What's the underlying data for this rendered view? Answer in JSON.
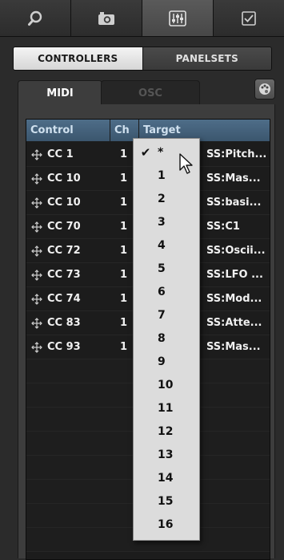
{
  "toolbar": {
    "tabs": [
      {
        "icon": "search-icon"
      },
      {
        "icon": "camera-icon"
      },
      {
        "icon": "mixer-sliders-icon"
      },
      {
        "icon": "checkbox-icon"
      }
    ]
  },
  "segmented": {
    "controllers": "CONTROLLERS",
    "panelsets": "PANELSETS"
  },
  "subtabs": {
    "midi": "MIDI",
    "osc": "OSC"
  },
  "table": {
    "headers": {
      "control": "Control",
      "ch": "Ch",
      "target": "Target"
    },
    "rows": [
      {
        "control": "CC 1",
        "ch": "1",
        "target": "SS:Pitch..."
      },
      {
        "control": "CC 10",
        "ch": "1",
        "target": "SS:Mas..."
      },
      {
        "control": "CC 10",
        "ch": "1",
        "target": "SS:basi..."
      },
      {
        "control": "CC 70",
        "ch": "1",
        "target": "SS:C1"
      },
      {
        "control": "CC 72",
        "ch": "1",
        "target": "SS:Oscii..."
      },
      {
        "control": "CC 73",
        "ch": "1",
        "target": "SS:LFO ..."
      },
      {
        "control": "CC 74",
        "ch": "1",
        "target": "SS:Mod..."
      },
      {
        "control": "CC 83",
        "ch": "1",
        "target": "SS:Atte..."
      },
      {
        "control": "CC 93",
        "ch": "1",
        "target": "SS:Mas..."
      }
    ]
  },
  "dropdown": {
    "selected": "*",
    "options": [
      "*",
      "1",
      "2",
      "3",
      "4",
      "5",
      "6",
      "7",
      "8",
      "9",
      "10",
      "11",
      "12",
      "13",
      "14",
      "15",
      "16"
    ]
  }
}
